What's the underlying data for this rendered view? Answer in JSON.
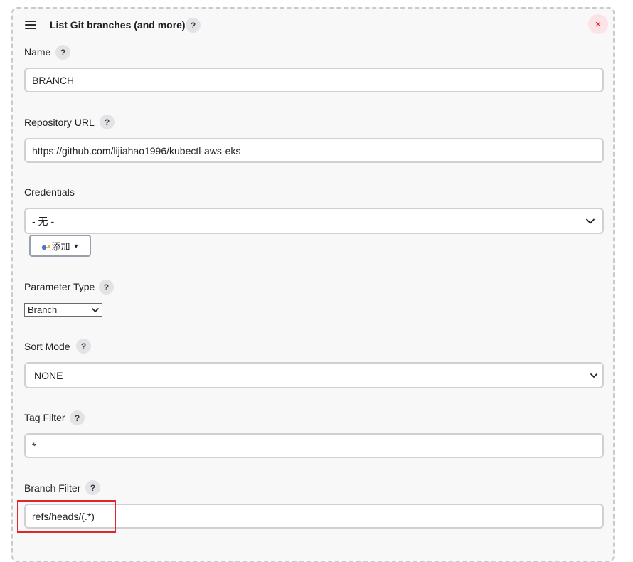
{
  "card": {
    "title": "List Git branches (and more)",
    "help": "?",
    "close": "×"
  },
  "name": {
    "label": "Name",
    "help": "?",
    "value": "BRANCH"
  },
  "repository": {
    "label": "Repository URL",
    "help": "?",
    "value": "https://github.com/lijiahao1996/kubectl-aws-eks"
  },
  "credentials": {
    "label": "Credentials",
    "selected": "- 无 -",
    "add_label": "添加"
  },
  "parameter_type": {
    "label": "Parameter Type",
    "help": "?",
    "selected": "Branch"
  },
  "sort_mode": {
    "label": "Sort Mode",
    "help": "?",
    "selected": "NONE"
  },
  "tag_filter": {
    "label": "Tag Filter",
    "help": "?",
    "value": "*"
  },
  "branch_filter": {
    "label": "Branch Filter",
    "help": "?",
    "value": "refs/heads/(.*)"
  },
  "colors": {
    "highlight": "#e0262b",
    "close": "#e0263f"
  }
}
